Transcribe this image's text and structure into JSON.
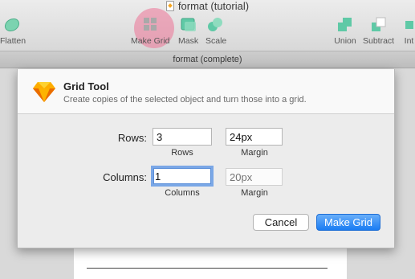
{
  "window": {
    "title": "format (tutorial)"
  },
  "toolbar": {
    "flatten_label": "Flatten",
    "make_grid_label": "Make Grid",
    "mask_label": "Mask",
    "scale_label": "Scale",
    "union_label": "Union",
    "subtract_label": "Subtract",
    "intersect_label": "Int"
  },
  "tab": {
    "label": "format (complete)"
  },
  "dialog": {
    "title": "Grid Tool",
    "subtitle": "Create copies of the selected object and turn those into a grid.",
    "rows_label": "Rows:",
    "rows_value": "3",
    "rows_caption": "Rows",
    "rows_margin_value": "24px",
    "rows_margin_caption": "Margin",
    "columns_label": "Columns:",
    "columns_value": "1",
    "columns_caption": "Columns",
    "columns_margin_placeholder": "20px",
    "columns_margin_caption": "Margin",
    "cancel_label": "Cancel",
    "submit_label": "Make Grid"
  },
  "colors": {
    "accent": "#1a7cf3",
    "highlight": "#ec7296",
    "tool_teal": "#5fc9a6",
    "gem_orange": "#f5a623"
  },
  "icons": [
    "document-icon",
    "flatten-icon",
    "make-grid-icon",
    "mask-icon",
    "scale-icon",
    "union-icon",
    "subtract-icon",
    "sketch-gem-icon"
  ]
}
